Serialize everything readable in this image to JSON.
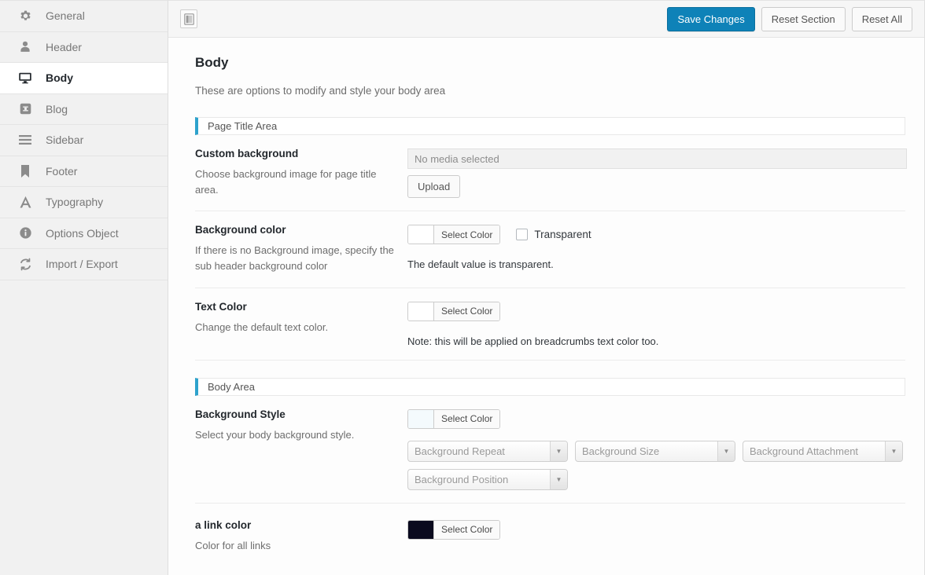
{
  "sidebar": {
    "items": [
      {
        "label": "General",
        "icon": "gear-icon",
        "active": false
      },
      {
        "label": "Header",
        "icon": "user-icon",
        "active": false
      },
      {
        "label": "Body",
        "icon": "monitor-icon",
        "active": true
      },
      {
        "label": "Blog",
        "icon": "blog-icon",
        "active": false
      },
      {
        "label": "Sidebar",
        "icon": "menu-icon",
        "active": false
      },
      {
        "label": "Footer",
        "icon": "bookmark-icon",
        "active": false
      },
      {
        "label": "Typography",
        "icon": "letter-a-icon",
        "active": false
      },
      {
        "label": "Options Object",
        "icon": "info-icon",
        "active": false
      },
      {
        "label": "Import / Export",
        "icon": "sync-icon",
        "active": false
      }
    ]
  },
  "toolbar": {
    "expand_icon": "panel-layout-icon",
    "save_label": "Save Changes",
    "reset_section_label": "Reset Section",
    "reset_all_label": "Reset All",
    "primary_color": "#0e82b8"
  },
  "page": {
    "title": "Body",
    "subtitle": "These are options to modify and style your body area"
  },
  "sections": {
    "page_title_area": {
      "heading": "Page Title Area",
      "accent_color": "#2ea2cc"
    },
    "body_area": {
      "heading": "Body Area",
      "accent_color": "#2ea2cc"
    }
  },
  "fields": {
    "custom_background": {
      "title": "Custom background",
      "desc": "Choose background image for page title area.",
      "media_placeholder": "No media selected",
      "upload_label": "Upload"
    },
    "background_color": {
      "title": "Background color",
      "desc": "If there is no Background image, specify the sub header background color",
      "select_color_label": "Select Color",
      "swatch_color": "#ffffff",
      "transparent_label": "Transparent",
      "transparent_checked": false,
      "note": "The default value is transparent."
    },
    "text_color": {
      "title": "Text Color",
      "desc": "Change the default text color.",
      "select_color_label": "Select Color",
      "swatch_color": "#ffffff",
      "note": "Note: this will be applied on breadcrumbs text color too."
    },
    "background_style": {
      "title": "Background Style",
      "desc": "Select your body background style.",
      "select_color_label": "Select Color",
      "swatch_color": "#f4fafd",
      "selects": [
        {
          "placeholder": "Background Repeat"
        },
        {
          "placeholder": "Background Size"
        },
        {
          "placeholder": "Background Attachment"
        },
        {
          "placeholder": "Background Position"
        }
      ]
    },
    "a_link_color": {
      "title": "a link color",
      "desc": "Color for all links",
      "select_color_label": "Select Color",
      "swatch_color": "#0a0a1e"
    }
  }
}
